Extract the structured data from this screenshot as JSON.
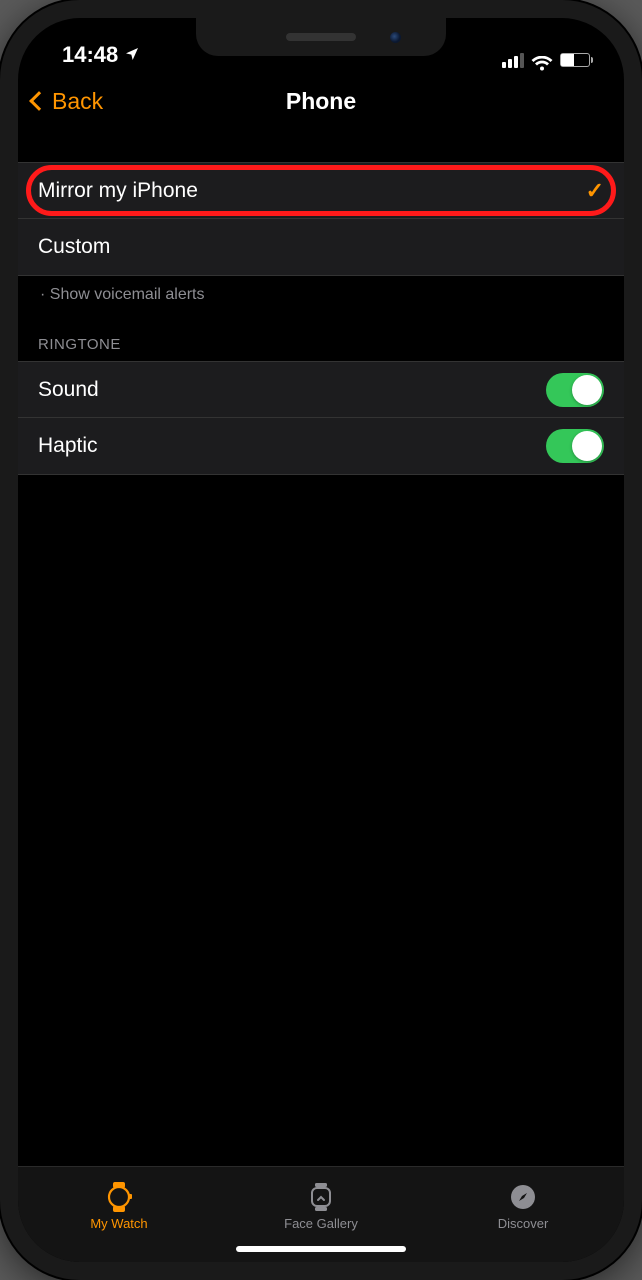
{
  "status": {
    "time": "14:48",
    "location_services": true
  },
  "nav": {
    "back_label": "Back",
    "title": "Phone"
  },
  "alerts": {
    "options": [
      {
        "label": "Mirror my iPhone",
        "selected": true,
        "highlighted": true
      },
      {
        "label": "Custom",
        "selected": false,
        "highlighted": false
      }
    ],
    "footer": "· Show voicemail alerts"
  },
  "ringtone": {
    "header": "RINGTONE",
    "rows": [
      {
        "label": "Sound",
        "value": true
      },
      {
        "label": "Haptic",
        "value": true
      }
    ]
  },
  "tabs": [
    {
      "label": "My Watch",
      "icon": "watch-icon",
      "active": true
    },
    {
      "label": "Face Gallery",
      "icon": "face-gallery-icon",
      "active": false
    },
    {
      "label": "Discover",
      "icon": "compass-icon",
      "active": false
    }
  ]
}
